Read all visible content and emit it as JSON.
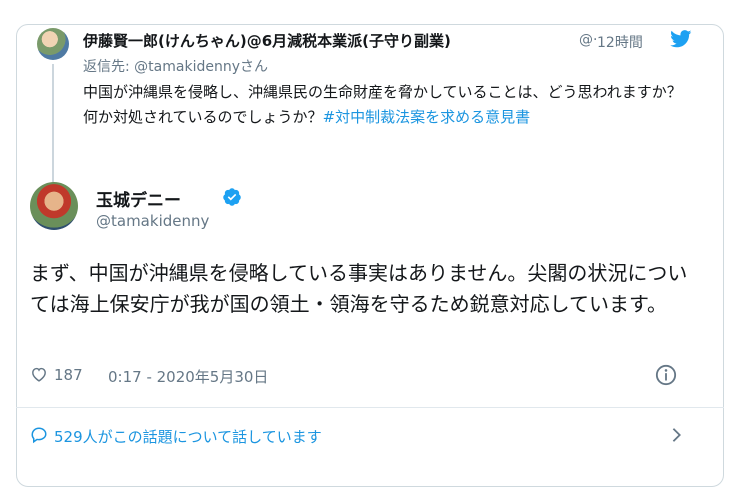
{
  "reply_tweet": {
    "author_name": "伊藤賢一郎(けんちゃん)@6月減税本業派(子守り副業)",
    "handle_truncated": "@·",
    "time": "12時間",
    "reply_to_label": "返信先:",
    "reply_to_handle": "@tamakidennyさん",
    "text": "中国が沖縄県を侵略し、沖縄県民の生命財産を脅かしていることは、どう思われますか？何か対処されているのでしょうか？",
    "hashtag": "#対中制裁法案を求める意見書"
  },
  "main_tweet": {
    "author_name": "玉城デニー",
    "handle": "@tamakidenny",
    "text": "まず、中国が沖縄県を侵略している事実はありません。尖閣の状況については海上保安庁が我が国の領土・領海を守るため鋭意対応しています。",
    "likes": "187",
    "datetime": "0:17 - 2020年5月30日"
  },
  "conversation": {
    "label": "529人がこの話題について話しています"
  },
  "colors": {
    "link": "#1b95e0",
    "muted": "#657786",
    "verified": "#1da1f2"
  },
  "icons": [
    "twitter-bird-icon",
    "verified-badge-icon",
    "heart-icon",
    "info-icon",
    "reply-bubble-icon",
    "chevron-right-icon"
  ]
}
